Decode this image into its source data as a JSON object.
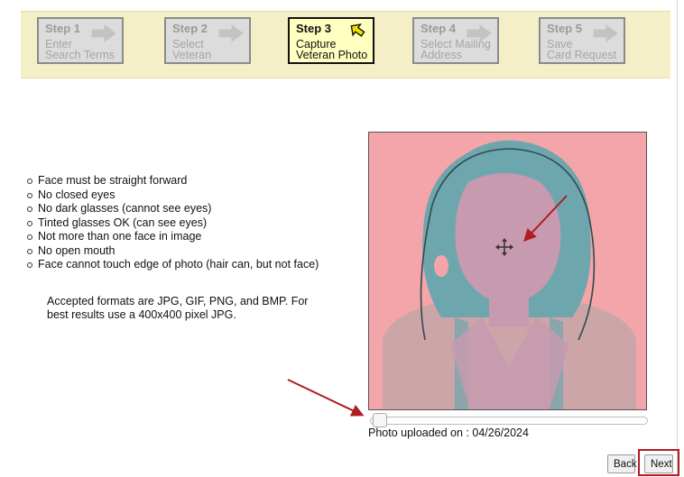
{
  "steps": [
    {
      "number": "Step 1",
      "label_line1": "Enter",
      "label_line2": "Search Terms",
      "active": false
    },
    {
      "number": "Step 2",
      "label_line1": "Select",
      "label_line2": "Veteran",
      "active": false
    },
    {
      "number": "Step 3",
      "label_line1": "Capture",
      "label_line2": "Veteran Photo",
      "active": true
    },
    {
      "number": "Step 4",
      "label_line1": "Select Mailing",
      "label_line2": "Address",
      "active": false
    },
    {
      "number": "Step 5",
      "label_line1": "Save",
      "label_line2": "Card Request",
      "active": false
    }
  ],
  "guidelines": [
    "Face must be straight forward",
    "No closed eyes",
    "No dark glasses (cannot see eyes)",
    "Tinted glasses OK (can see eyes)",
    "Not more than one face in image",
    "No open mouth",
    "Face cannot touch edge of photo (hair can, but not face)"
  ],
  "formats_note": "Accepted formats are JPG, GIF, PNG, and BMP. For best results use a 400x400 pixel JPG.",
  "photo": {
    "upload_label": "Photo uploaded on : 04/26/2024",
    "zoom_level": 0
  },
  "buttons": {
    "back": "Back",
    "next": "Next"
  },
  "colors": {
    "steps_background": "#f4efc6",
    "active_step": "#ffffc0",
    "inactive_step": "#dcdcdc",
    "annotation": "#b11c22"
  },
  "icons": {
    "step_arrow": "right-arrow-icon",
    "active_step_arrow": "pointing-arrow-icon",
    "photo_cursor": "move-cursor-icon"
  }
}
